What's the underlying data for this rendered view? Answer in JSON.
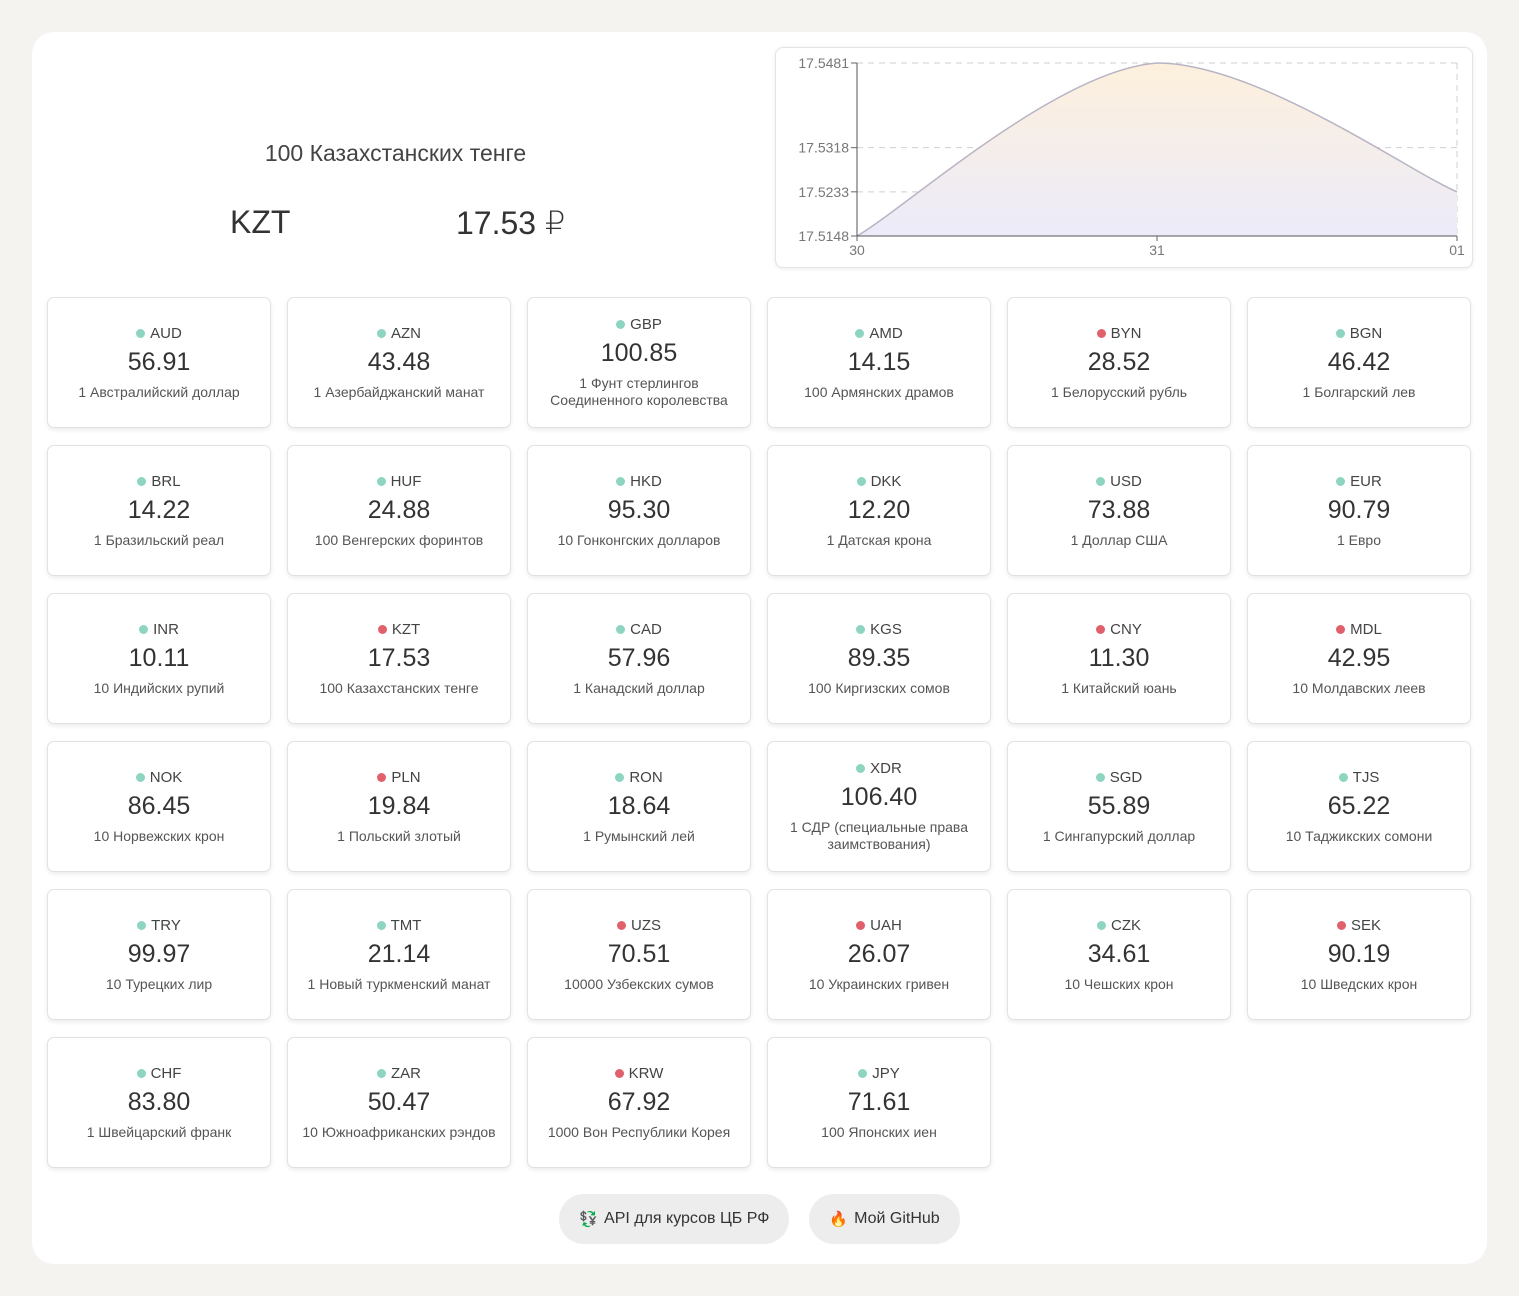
{
  "hero": {
    "name": "100 Казахстанских тенге",
    "code": "KZT",
    "value": "17.53 ₽"
  },
  "chart_data": {
    "type": "area",
    "x": [
      "30",
      "31",
      "01"
    ],
    "series": [
      {
        "values": [
          17.5148,
          17.5481,
          17.5233
        ]
      }
    ],
    "yticks": [
      "17.5481",
      "17.5318",
      "17.5233",
      "17.5148"
    ],
    "ylim": [
      17.5148,
      17.5481
    ],
    "grid": true,
    "colors": {
      "top": "#fdf0dc",
      "bottom": "#ecebfa",
      "line": "#b9b4c4"
    }
  },
  "colors": {
    "up": "#8dd5c0",
    "down": "#e0616c"
  },
  "currencies": [
    {
      "code": "AUD",
      "value": "56.91",
      "name": "1 Австралийский доллар",
      "trend": "up"
    },
    {
      "code": "AZN",
      "value": "43.48",
      "name": "1 Азербайджанский манат",
      "trend": "up"
    },
    {
      "code": "GBP",
      "value": "100.85",
      "name": "1 Фунт стерлингов Соединенного королевства",
      "trend": "up"
    },
    {
      "code": "AMD",
      "value": "14.15",
      "name": "100 Армянских драмов",
      "trend": "up"
    },
    {
      "code": "BYN",
      "value": "28.52",
      "name": "1 Белорусский рубль",
      "trend": "down"
    },
    {
      "code": "BGN",
      "value": "46.42",
      "name": "1 Болгарский лев",
      "trend": "up"
    },
    {
      "code": "BRL",
      "value": "14.22",
      "name": "1 Бразильский реал",
      "trend": "up"
    },
    {
      "code": "HUF",
      "value": "24.88",
      "name": "100 Венгерских форинтов",
      "trend": "up"
    },
    {
      "code": "HKD",
      "value": "95.30",
      "name": "10 Гонконгских долларов",
      "trend": "up"
    },
    {
      "code": "DKK",
      "value": "12.20",
      "name": "1 Датская крона",
      "trend": "up"
    },
    {
      "code": "USD",
      "value": "73.88",
      "name": "1 Доллар США",
      "trend": "up"
    },
    {
      "code": "EUR",
      "value": "90.79",
      "name": "1 Евро",
      "trend": "up"
    },
    {
      "code": "INR",
      "value": "10.11",
      "name": "10 Индийских рупий",
      "trend": "up"
    },
    {
      "code": "KZT",
      "value": "17.53",
      "name": "100 Казахстанских тенге",
      "trend": "down"
    },
    {
      "code": "CAD",
      "value": "57.96",
      "name": "1 Канадский доллар",
      "trend": "up"
    },
    {
      "code": "KGS",
      "value": "89.35",
      "name": "100 Киргизских сомов",
      "trend": "up"
    },
    {
      "code": "CNY",
      "value": "11.30",
      "name": "1 Китайский юань",
      "trend": "down"
    },
    {
      "code": "MDL",
      "value": "42.95",
      "name": "10 Молдавских леев",
      "trend": "down"
    },
    {
      "code": "NOK",
      "value": "86.45",
      "name": "10 Норвежских крон",
      "trend": "up"
    },
    {
      "code": "PLN",
      "value": "19.84",
      "name": "1 Польский злотый",
      "trend": "down"
    },
    {
      "code": "RON",
      "value": "18.64",
      "name": "1 Румынский лей",
      "trend": "up"
    },
    {
      "code": "XDR",
      "value": "106.40",
      "name": "1 СДР (специальные права заимствования)",
      "trend": "up"
    },
    {
      "code": "SGD",
      "value": "55.89",
      "name": "1 Сингапурский доллар",
      "trend": "up"
    },
    {
      "code": "TJS",
      "value": "65.22",
      "name": "10 Таджикских сомони",
      "trend": "up"
    },
    {
      "code": "TRY",
      "value": "99.97",
      "name": "10 Турецких лир",
      "trend": "up"
    },
    {
      "code": "TMT",
      "value": "21.14",
      "name": "1 Новый туркменский манат",
      "trend": "up"
    },
    {
      "code": "UZS",
      "value": "70.51",
      "name": "10000 Узбекских сумов",
      "trend": "down"
    },
    {
      "code": "UAH",
      "value": "26.07",
      "name": "10 Украинских гривен",
      "trend": "down"
    },
    {
      "code": "CZK",
      "value": "34.61",
      "name": "10 Чешских крон",
      "trend": "up"
    },
    {
      "code": "SEK",
      "value": "90.19",
      "name": "10 Шведских крон",
      "trend": "down"
    },
    {
      "code": "CHF",
      "value": "83.80",
      "name": "1 Швейцарский франк",
      "trend": "up"
    },
    {
      "code": "ZAR",
      "value": "50.47",
      "name": "10 Южноафриканских рэндов",
      "trend": "up"
    },
    {
      "code": "KRW",
      "value": "67.92",
      "name": "1000 Вон Республики Корея",
      "trend": "down"
    },
    {
      "code": "JPY",
      "value": "71.61",
      "name": "100 Японских иен",
      "trend": "up"
    }
  ],
  "links": [
    {
      "icon": "exchange-icon",
      "glyph": "💱",
      "label": "API для курсов ЦБ РФ"
    },
    {
      "icon": "fire-icon",
      "glyph": "🔥",
      "label": "Мой GitHub"
    }
  ]
}
